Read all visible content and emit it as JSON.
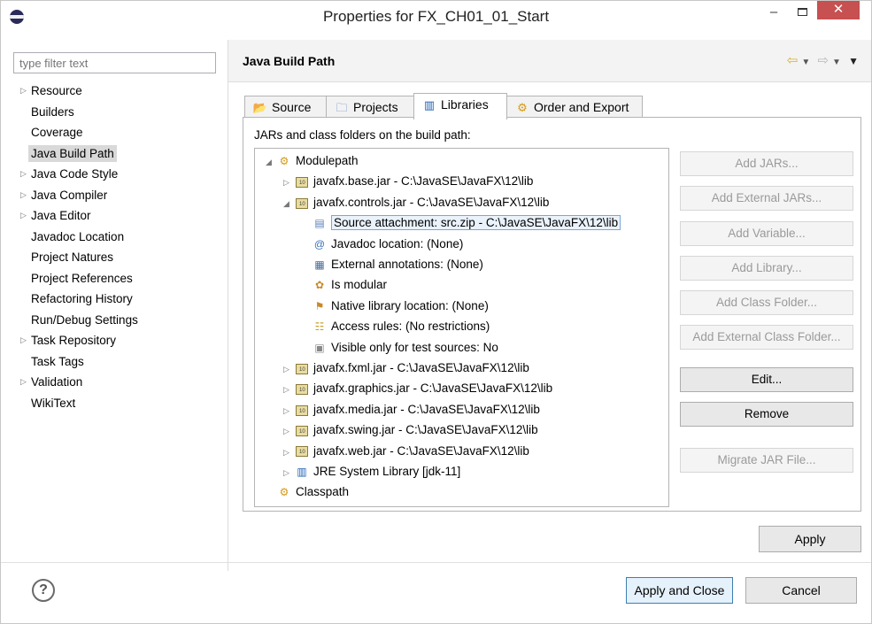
{
  "window": {
    "title": "Properties for FX_CH01_01_Start",
    "minimize_glyph": "–",
    "close_glyph": "✕"
  },
  "left": {
    "filter_placeholder": "type filter text",
    "items": [
      {
        "label": "Resource",
        "expandable": true,
        "selected": false
      },
      {
        "label": "Builders",
        "expandable": false,
        "selected": false
      },
      {
        "label": "Coverage",
        "expandable": false,
        "selected": false
      },
      {
        "label": "Java Build Path",
        "expandable": false,
        "selected": true
      },
      {
        "label": "Java Code Style",
        "expandable": true,
        "selected": false
      },
      {
        "label": "Java Compiler",
        "expandable": true,
        "selected": false
      },
      {
        "label": "Java Editor",
        "expandable": true,
        "selected": false
      },
      {
        "label": "Javadoc Location",
        "expandable": false,
        "selected": false
      },
      {
        "label": "Project Natures",
        "expandable": false,
        "selected": false
      },
      {
        "label": "Project References",
        "expandable": false,
        "selected": false
      },
      {
        "label": "Refactoring History",
        "expandable": false,
        "selected": false
      },
      {
        "label": "Run/Debug Settings",
        "expandable": false,
        "selected": false
      },
      {
        "label": "Task Repository",
        "expandable": true,
        "selected": false
      },
      {
        "label": "Task Tags",
        "expandable": false,
        "selected": false
      },
      {
        "label": "Validation",
        "expandable": true,
        "selected": false
      },
      {
        "label": "WikiText",
        "expandable": false,
        "selected": false
      }
    ]
  },
  "page": {
    "title": "Java Build Path",
    "tabs": [
      {
        "label": "Source",
        "icon": "source-folder-icon",
        "active": false
      },
      {
        "label": "Projects",
        "icon": "projects-icon",
        "active": false
      },
      {
        "label": "Libraries",
        "icon": "libraries-icon",
        "active": true
      },
      {
        "label": "Order and Export",
        "icon": "order-export-icon",
        "active": false
      }
    ],
    "build_path_label": "JARs and class folders on the build path:",
    "tree": [
      {
        "label": "Modulepath",
        "level": 0,
        "twisty": "expanded",
        "icon": "modulepath-icon"
      },
      {
        "label": "javafx.base.jar - C:\\JavaSE\\JavaFX\\12\\lib",
        "level": 1,
        "twisty": "collapsed",
        "icon": "jar-icon"
      },
      {
        "label": "javafx.controls.jar - C:\\JavaSE\\JavaFX\\12\\lib",
        "level": 1,
        "twisty": "expanded",
        "icon": "jar-icon"
      },
      {
        "label": "Source attachment: src.zip - C:\\JavaSE\\JavaFX\\12\\lib",
        "level": 2,
        "twisty": "none",
        "icon": "source-attachment-icon",
        "selected": true
      },
      {
        "label": "Javadoc location: (None)",
        "level": 2,
        "twisty": "none",
        "icon": "javadoc-icon"
      },
      {
        "label": "External annotations: (None)",
        "level": 2,
        "twisty": "none",
        "icon": "annotations-icon"
      },
      {
        "label": "Is modular",
        "level": 2,
        "twisty": "none",
        "icon": "modular-icon"
      },
      {
        "label": "Native library location: (None)",
        "level": 2,
        "twisty": "none",
        "icon": "native-library-icon"
      },
      {
        "label": "Access rules: (No restrictions)",
        "level": 2,
        "twisty": "none",
        "icon": "access-rules-icon"
      },
      {
        "label": "Visible only for test sources: No",
        "level": 2,
        "twisty": "none",
        "icon": "test-sources-icon"
      },
      {
        "label": "javafx.fxml.jar - C:\\JavaSE\\JavaFX\\12\\lib",
        "level": 1,
        "twisty": "collapsed",
        "icon": "jar-icon"
      },
      {
        "label": "javafx.graphics.jar - C:\\JavaSE\\JavaFX\\12\\lib",
        "level": 1,
        "twisty": "collapsed",
        "icon": "jar-icon"
      },
      {
        "label": "javafx.media.jar - C:\\JavaSE\\JavaFX\\12\\lib",
        "level": 1,
        "twisty": "collapsed",
        "icon": "jar-icon"
      },
      {
        "label": "javafx.swing.jar - C:\\JavaSE\\JavaFX\\12\\lib",
        "level": 1,
        "twisty": "collapsed",
        "icon": "jar-icon"
      },
      {
        "label": "javafx.web.jar - C:\\JavaSE\\JavaFX\\12\\lib",
        "level": 1,
        "twisty": "collapsed",
        "icon": "jar-icon"
      },
      {
        "label": "JRE System Library [jdk-11]",
        "level": 1,
        "twisty": "collapsed",
        "icon": "jre-library-icon"
      },
      {
        "label": "Classpath",
        "level": 0,
        "twisty": "none",
        "icon": "classpath-icon"
      }
    ],
    "side_buttons": [
      {
        "label": "Add JARs...",
        "enabled": false,
        "name": "add-jars-button"
      },
      {
        "label": "Add External JARs...",
        "enabled": false,
        "name": "add-external-jars-button"
      },
      {
        "label": "Add Variable...",
        "enabled": false,
        "name": "add-variable-button"
      },
      {
        "label": "Add Library...",
        "enabled": false,
        "name": "add-library-button"
      },
      {
        "label": "Add Class Folder...",
        "enabled": false,
        "name": "add-class-folder-button"
      },
      {
        "label": "Add External Class Folder...",
        "enabled": false,
        "name": "add-external-class-folder-button"
      },
      {
        "label": "Edit...",
        "enabled": true,
        "name": "edit-button"
      },
      {
        "label": "Remove",
        "enabled": true,
        "name": "remove-button"
      },
      {
        "label": "Migrate JAR File...",
        "enabled": false,
        "name": "migrate-jar-button"
      }
    ],
    "apply_label": "Apply"
  },
  "footer": {
    "help_glyph": "?",
    "apply_close_label": "Apply and Close",
    "cancel_label": "Cancel"
  },
  "colors": {
    "accent": "#d4b232",
    "close_button": "#c75050",
    "selected_row_border": "#7fa6d1"
  }
}
